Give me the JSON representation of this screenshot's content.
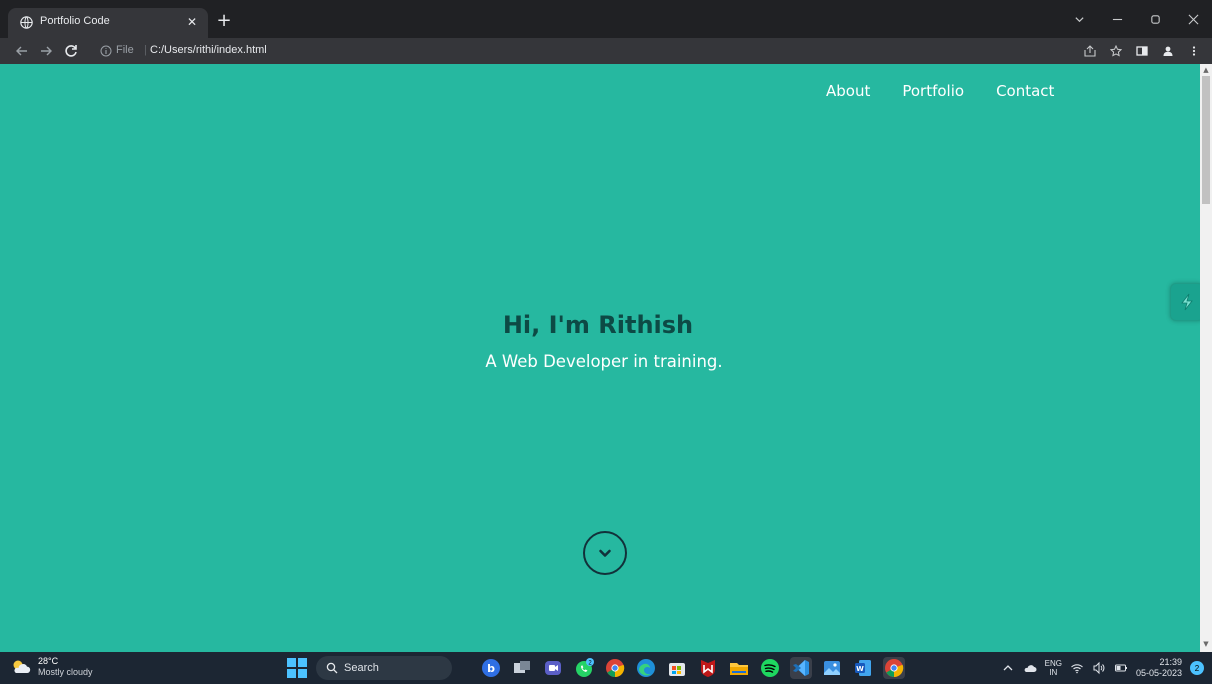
{
  "browser": {
    "tab_title": "Portfolio Code",
    "file_label": "File",
    "separator": "|",
    "url": "C:/Users/rithi/index.html"
  },
  "site": {
    "nav": [
      "About",
      "Portfolio",
      "Contact"
    ],
    "hero_title": "Hi, I'm Rithish",
    "hero_subtitle": "A Web Developer in training."
  },
  "colors": {
    "page_background": "#26b8a0",
    "hero_title": "#0d4a45",
    "accent": "#12313a"
  },
  "taskbar": {
    "weather_temp": "28°C",
    "weather_condition": "Mostly cloudy",
    "search_label": "Search",
    "language_1": "ENG",
    "language_2": "IN",
    "time": "21:39",
    "date": "05-05-2023",
    "notification_count": "2",
    "whatsapp_badge": "2"
  }
}
